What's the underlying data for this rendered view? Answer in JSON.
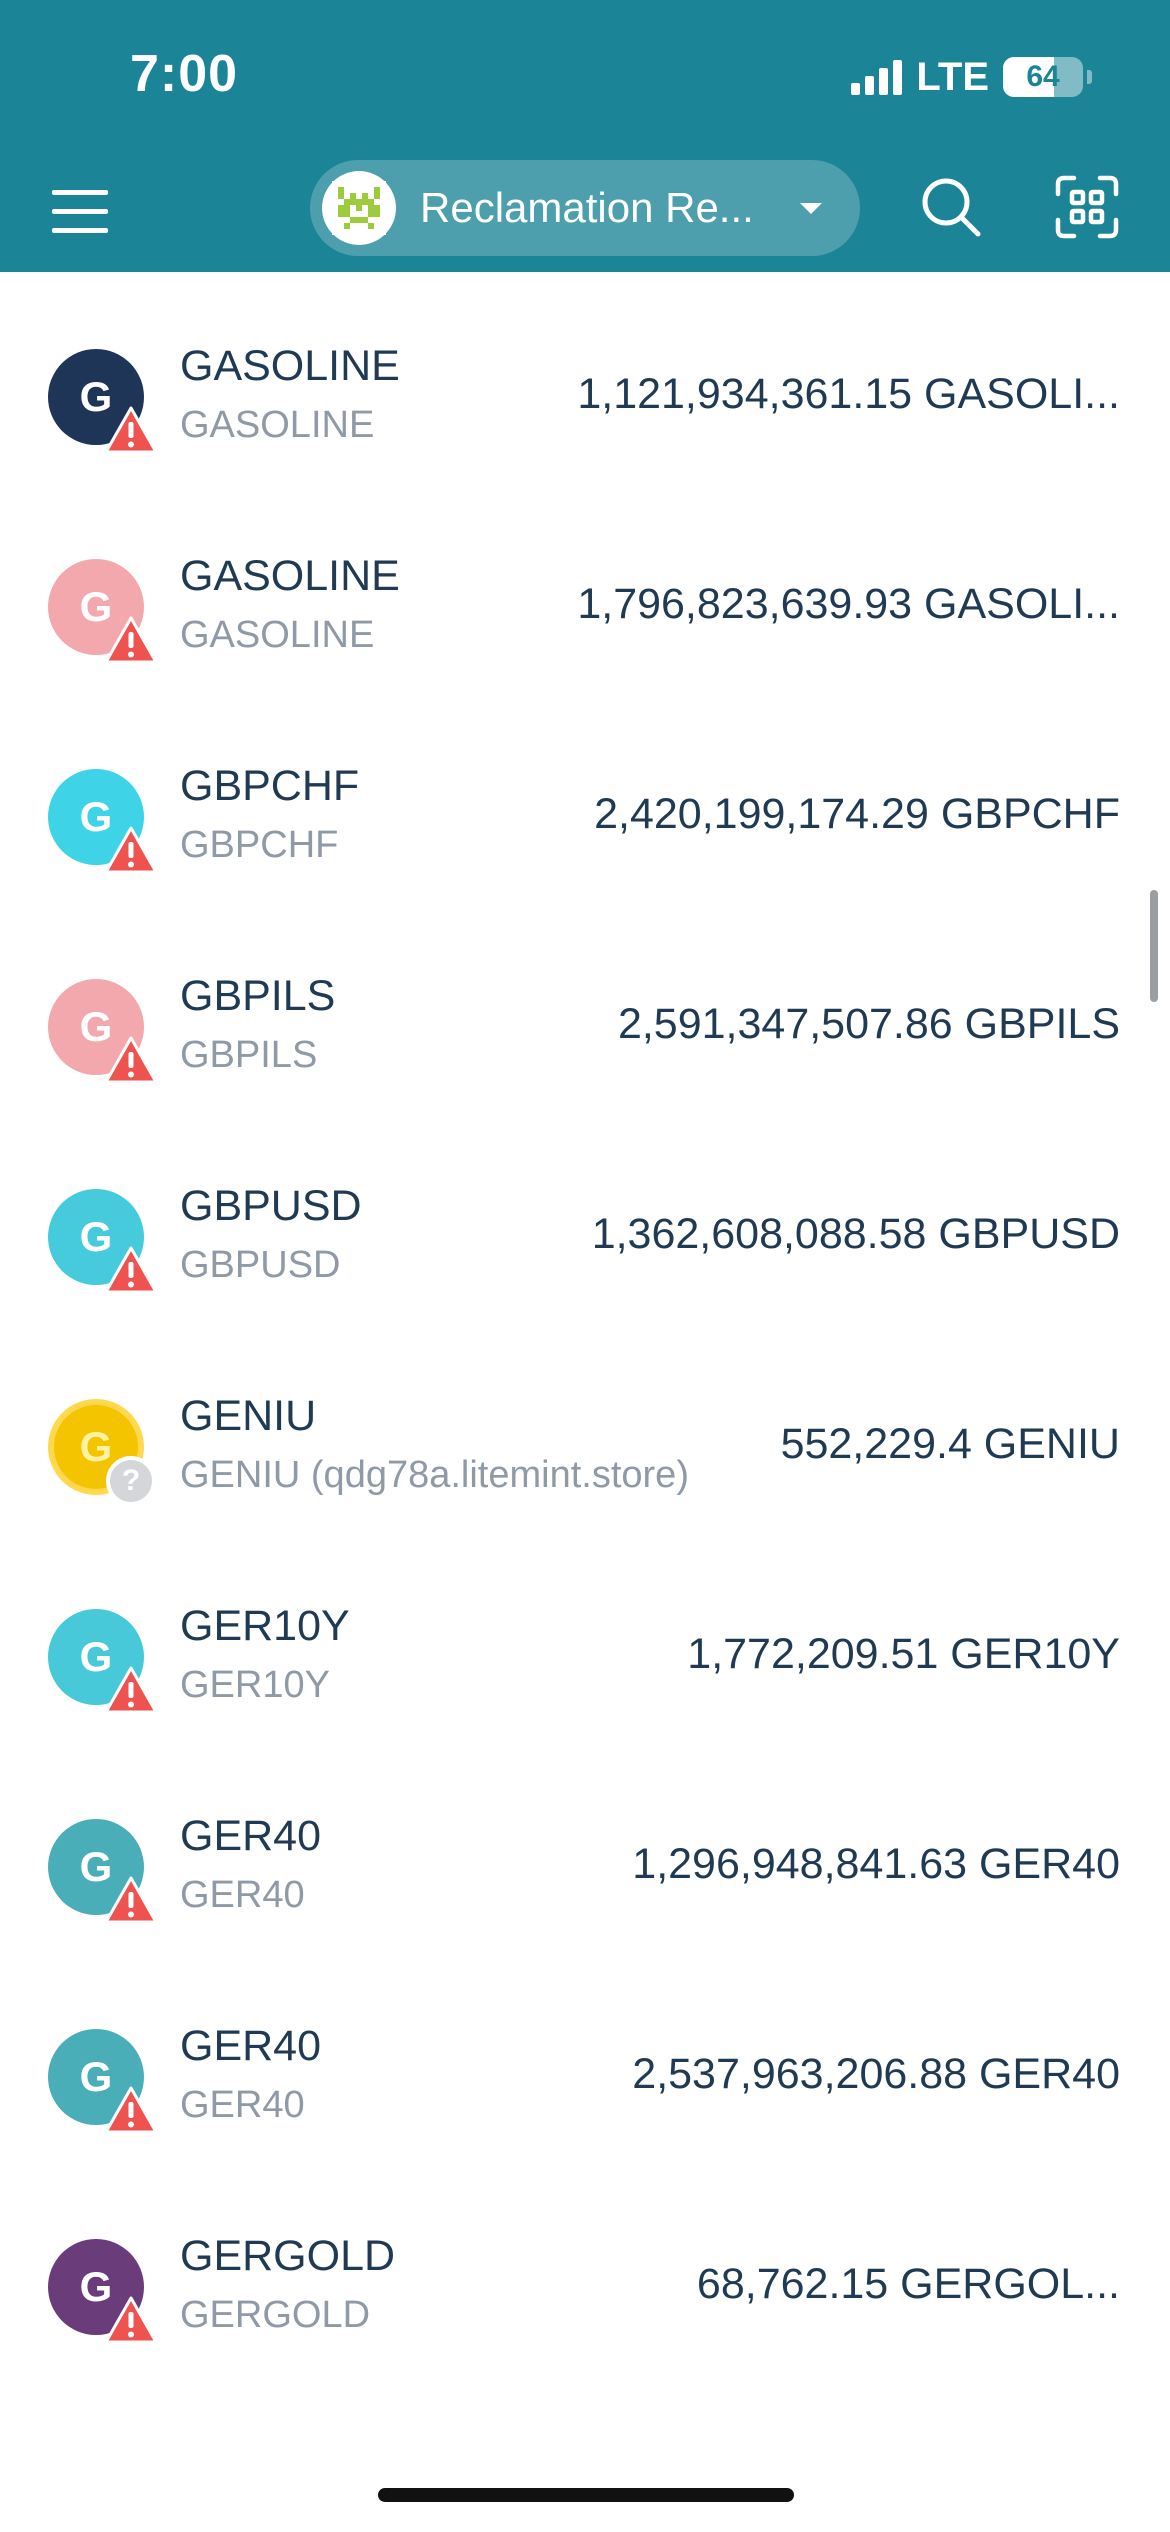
{
  "colors": {
    "brand": "#1b8497",
    "warning": "#ef5350"
  },
  "status_bar": {
    "time": "7:00",
    "network": "LTE",
    "battery_percent": 64,
    "battery_label": "64",
    "signal_bars": 4
  },
  "nav": {
    "menu_icon": "hamburger-menu-icon",
    "account_name": "Reclamation Re...",
    "account_avatar_icon": "identicon-avatar",
    "dropdown_icon": "caret-down-icon",
    "search_icon": "search-icon",
    "scan_icon": "qr-scan-icon"
  },
  "assets": [
    {
      "letter": "G",
      "color": "#1e3557",
      "code": "GASOLINE",
      "issuer": "GASOLINE",
      "amount": "1,121,934,361.15 GASOLI...",
      "badge": "warning"
    },
    {
      "letter": "G",
      "color": "#f2a8ad",
      "code": "GASOLINE",
      "issuer": "GASOLINE",
      "amount": "1,796,823,639.93 GASOLI...",
      "badge": "warning"
    },
    {
      "letter": "G",
      "color": "#3fd3e8",
      "code": "GBPCHF",
      "issuer": "GBPCHF",
      "amount": "2,420,199,174.29 GBPCHF",
      "badge": "warning"
    },
    {
      "letter": "G",
      "color": "#f2a8ad",
      "code": "GBPILS",
      "issuer": "GBPILS",
      "amount": "2,591,347,507.86 GBPILS",
      "badge": "warning"
    },
    {
      "letter": "G",
      "color": "#45cbdc",
      "code": "GBPUSD",
      "issuer": "GBPUSD",
      "amount": "1,362,608,088.58 GBPUSD",
      "badge": "warning"
    },
    {
      "letter": "G",
      "color": "#f5c400",
      "code": "GENIU",
      "issuer": "GENIU (qdg78a.litemint.store)",
      "amount": "552,229.4 GENIU",
      "badge": "unknown",
      "gold": true
    },
    {
      "letter": "G",
      "color": "#47c9d9",
      "code": "GER10Y",
      "issuer": "GER10Y",
      "amount": "1,772,209.51 GER10Y",
      "badge": "warning"
    },
    {
      "letter": "G",
      "color": "#4aaeb8",
      "code": "GER40",
      "issuer": "GER40",
      "amount": "1,296,948,841.63 GER40",
      "badge": "warning"
    },
    {
      "letter": "G",
      "color": "#4aaeb8",
      "code": "GER40",
      "issuer": "GER40",
      "amount": "2,537,963,206.88 GER40",
      "badge": "warning"
    },
    {
      "letter": "G",
      "color": "#6b3c7a",
      "code": "GERGOLD",
      "issuer": "GERGOLD",
      "amount": "68,762.15 GERGOL...",
      "badge": "warning"
    }
  ]
}
